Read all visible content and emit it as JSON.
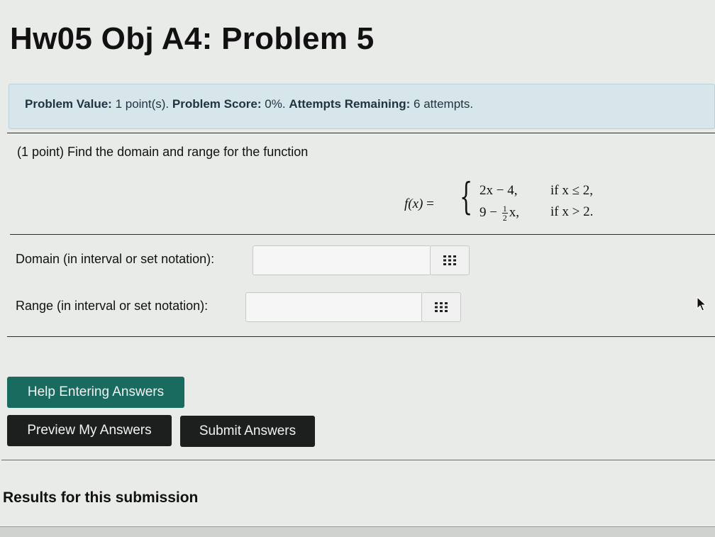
{
  "page": {
    "title": "Hw05 Obj A4: Problem 5"
  },
  "info": {
    "value_label": "Problem Value:",
    "value": "1 point(s).",
    "score_label": "Problem Score:",
    "score": "0%.",
    "attempts_label": "Attempts Remaining:",
    "attempts": "6 attempts."
  },
  "problem": {
    "text": "(1 point) Find the domain and range for the function",
    "function": {
      "lhs": "f(x)",
      "eq": "=",
      "case1_expr": "2x − 4,",
      "case1_cond": "if x ≤ 2,",
      "case2_prefix": "9 −",
      "case2_num": "1",
      "case2_den": "2",
      "case2_suffix": "x,",
      "case2_cond": "if x > 2."
    }
  },
  "domain": {
    "label": "Domain (in interval or set notation):",
    "value": "",
    "icon": "grid-icon"
  },
  "range": {
    "label": "Range (in interval or set notation):",
    "value": "",
    "icon": "grid-icon"
  },
  "buttons": {
    "help": "Help Entering Answers",
    "preview": "Preview My Answers",
    "submit": "Submit Answers"
  },
  "results": {
    "heading": "Results for this submission"
  },
  "colors": {
    "info_bg": "#d6e6ea",
    "help_btn": "#186b5e",
    "dark_btn": "#1c1f1e"
  }
}
